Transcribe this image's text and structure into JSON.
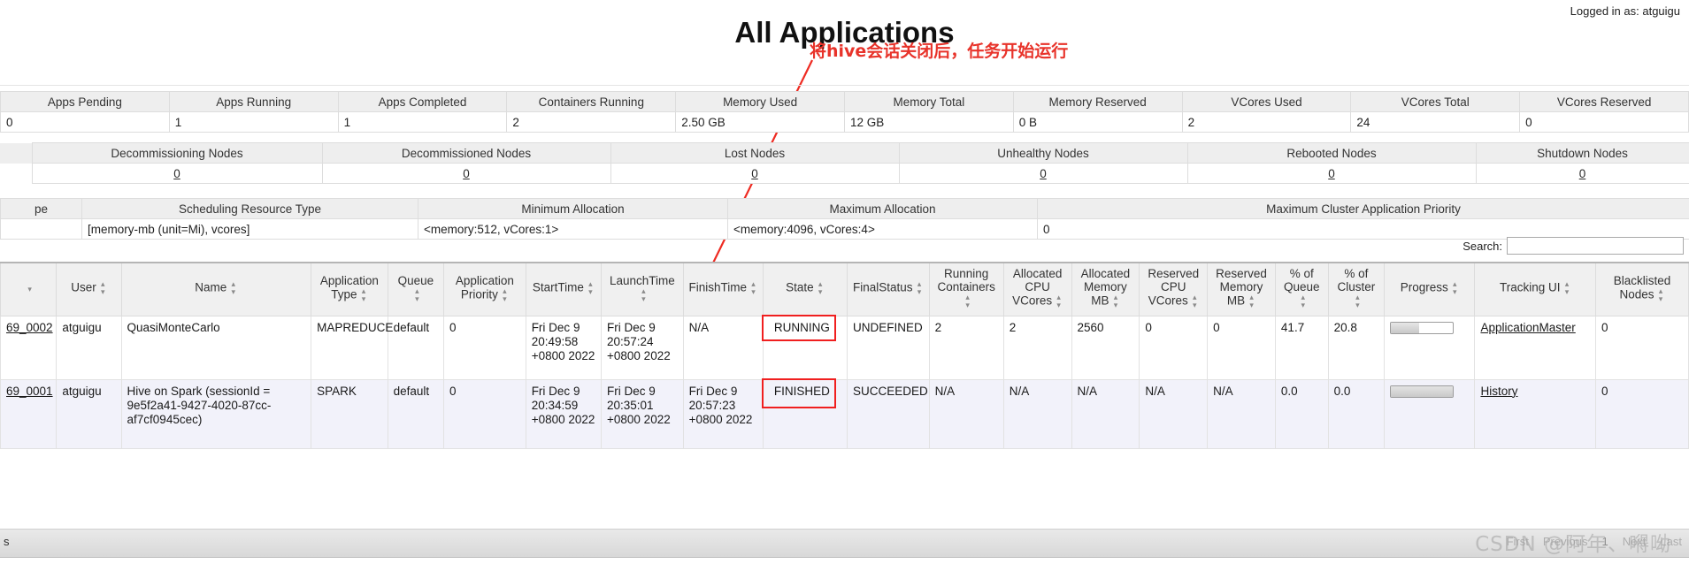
{
  "header": {
    "logged_in": "Logged in as: atguigu",
    "title": "All Applications"
  },
  "annotation": {
    "text": "将hive会话关闭后，任务开始运行",
    "color": "#e8332a"
  },
  "cluster_metrics": {
    "columns": [
      "Apps Pending",
      "Apps Running",
      "Apps Completed",
      "Containers Running",
      "Memory Used",
      "Memory Total",
      "Memory Reserved",
      "VCores Used",
      "VCores Total",
      "VCores Reserved"
    ],
    "values": [
      "0",
      "1",
      "1",
      "2",
      "2.50 GB",
      "12 GB",
      "0 B",
      "2",
      "24",
      "0"
    ]
  },
  "node_metrics": {
    "columns": [
      "Decommissioning Nodes",
      "Decommissioned Nodes",
      "Lost Nodes",
      "Unhealthy Nodes",
      "Rebooted Nodes",
      "Shutdown Nodes"
    ],
    "values": [
      "0",
      "0",
      "0",
      "0",
      "0",
      "0"
    ]
  },
  "scheduler_metrics": {
    "columns": [
      "pe",
      "Scheduling Resource Type",
      "Minimum Allocation",
      "Maximum Allocation",
      "Maximum Cluster Application Priority"
    ],
    "values": [
      "",
      "[memory-mb (unit=Mi), vcores]",
      "<memory:512, vCores:1>",
      "<memory:4096, vCores:4>",
      "0"
    ]
  },
  "search": {
    "label": "Search:",
    "value": "",
    "placeholder": ""
  },
  "apps_table": {
    "columns": [
      {
        "label": "",
        "sort": "desc"
      },
      {
        "label": "User",
        "sort": "both"
      },
      {
        "label": "Name",
        "sort": "both"
      },
      {
        "label": "Application Type",
        "sort": "both"
      },
      {
        "label": "Queue",
        "sort": "both"
      },
      {
        "label": "Application Priority",
        "sort": "both"
      },
      {
        "label": "StartTime",
        "sort": "both"
      },
      {
        "label": "LaunchTime",
        "sort": "both"
      },
      {
        "label": "FinishTime",
        "sort": "both"
      },
      {
        "label": "State",
        "sort": "both"
      },
      {
        "label": "FinalStatus",
        "sort": "both"
      },
      {
        "label": "Running Containers",
        "sort": "both"
      },
      {
        "label": "Allocated CPU VCores",
        "sort": "both"
      },
      {
        "label": "Allocated Memory MB",
        "sort": "both"
      },
      {
        "label": "Reserved CPU VCores",
        "sort": "both"
      },
      {
        "label": "Reserved Memory MB",
        "sort": "both"
      },
      {
        "label": "% of Queue",
        "sort": "both"
      },
      {
        "label": "% of Cluster",
        "sort": "both"
      },
      {
        "label": "Progress",
        "sort": "both"
      },
      {
        "label": "Tracking UI",
        "sort": "both"
      },
      {
        "label": "Blacklisted Nodes",
        "sort": "both"
      }
    ],
    "rows": [
      {
        "id": "69_0002",
        "user": "atguigu",
        "name": "QuasiMonteCarlo",
        "app_type": "MAPREDUCE",
        "queue": "default",
        "priority": "0",
        "start_time": "Fri Dec 9 20:49:58 +0800 2022",
        "launch_time": "Fri Dec 9 20:57:24 +0800 2022",
        "finish_time": "N/A",
        "state": "RUNNING",
        "final_status": "UNDEFINED",
        "running_containers": "2",
        "allocated_cpu_vcores": "2",
        "allocated_memory_mb": "2560",
        "reserved_cpu_vcores": "0",
        "reserved_memory_mb": "0",
        "pct_queue": "41.7",
        "pct_cluster": "20.8",
        "progress_pct": 45,
        "tracking_ui": "ApplicationMaster",
        "blacklisted_nodes": "0",
        "state_highlighted": true
      },
      {
        "id": "69_0001",
        "user": "atguigu",
        "name": "Hive on Spark (sessionId = 9e5f2a41-9427-4020-87cc-af7cf0945cec)",
        "app_type": "SPARK",
        "queue": "default",
        "priority": "0",
        "start_time": "Fri Dec 9 20:34:59 +0800 2022",
        "launch_time": "Fri Dec 9 20:35:01 +0800 2022",
        "finish_time": "Fri Dec 9 20:57:23 +0800 2022",
        "state": "FINISHED",
        "final_status": "SUCCEEDED",
        "running_containers": "N/A",
        "allocated_cpu_vcores": "N/A",
        "allocated_memory_mb": "N/A",
        "reserved_cpu_vcores": "N/A",
        "reserved_memory_mb": "N/A",
        "pct_queue": "0.0",
        "pct_cluster": "0.0",
        "progress_pct": 100,
        "tracking_ui": "History",
        "blacklisted_nodes": "0",
        "state_highlighted": true
      }
    ]
  },
  "footer": {
    "showing": "s",
    "pager": [
      "First",
      "Previous",
      "1",
      "Next",
      "Last"
    ],
    "watermark": "CSDN @阿年、嘚呦"
  }
}
